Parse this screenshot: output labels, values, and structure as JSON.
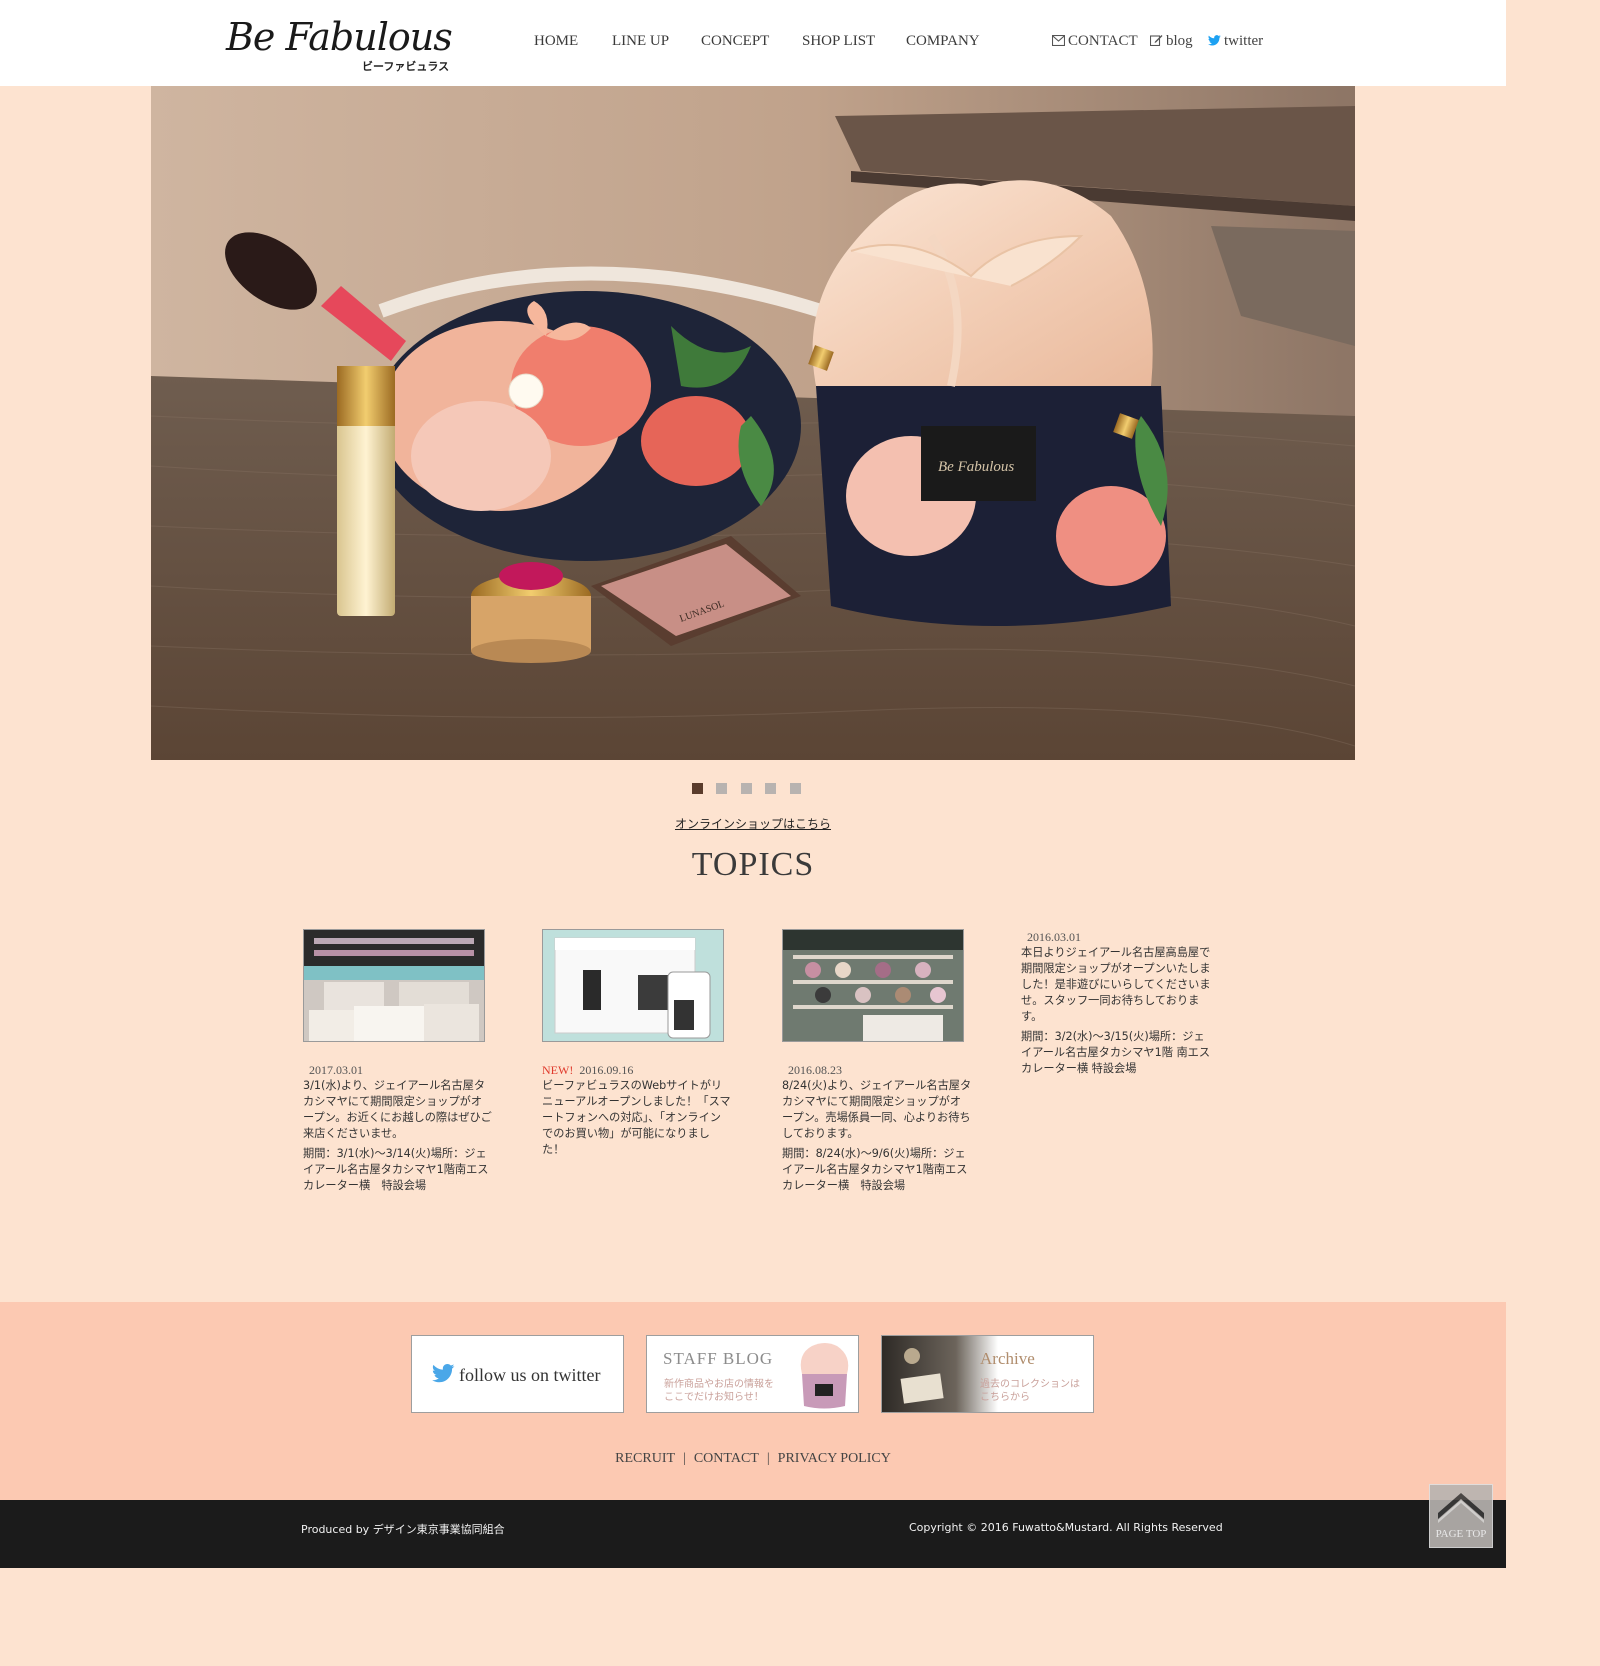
{
  "header": {
    "logo_script": "Be Fabulous",
    "logo_kana": "ビーファビュラス",
    "nav": [
      "HOME",
      "LINE UP",
      "CONCEPT",
      "SHOP LIST",
      "COMPANY"
    ],
    "utility": [
      {
        "label": "CONTACT",
        "icon": "envelope-icon"
      },
      {
        "label": "blog",
        "icon": "edit-icon"
      },
      {
        "label": "twitter",
        "icon": "twitter-bird-icon"
      }
    ]
  },
  "hero": {
    "slide_count": 5,
    "active_slide": 1,
    "bag_tag": "Be Fabulous",
    "compact_text": "LUNASOL"
  },
  "online_shop_link": "オンラインショップはこちら",
  "topics": {
    "title": "TOPICS",
    "items": [
      {
        "new": "",
        "date": "2017.03.01",
        "paragraphs": [
          "3/1(水)より、ジェイアール名古屋タカシマヤにて期間限定ショップがオープン。お近くにお越しの際はぜひご来店くださいませ。",
          "期間：3/1(水)〜3/14(火)場所：ジェイアール名古屋タカシマヤ1階南エスカレーター横　特設会場"
        ]
      },
      {
        "new": "NEW!",
        "date": "2016.09.16",
        "paragraphs": [
          "ビーファビュラスのWebサイトがリニューアルオープンしました！「スマートフォンへの対応」、「オンラインでのお買い物」が可能になりました！"
        ]
      },
      {
        "new": "",
        "date": "2016.08.23",
        "paragraphs": [
          "8/24(火)より、ジェイアール名古屋タカシマヤにて期間限定ショップがオープン。売場係員一同、心よりお待ちしております。",
          "期間：8/24(水)〜9/6(火)場所：ジェイアール名古屋タカシマヤ1階南エスカレーター横　特設会場"
        ]
      },
      {
        "new": "",
        "date": "2016.03.01",
        "paragraphs": [
          "本日よりジェイアール名古屋高島屋で期間限定ショップがオープンいたしました！是非遊びにいらしてくださいませ。スタッフ一同お待ちしております。",
          "期間：3/2(水)〜3/15(火)場所：ジェイアール名古屋タカシマヤ1階 南エスカレーター横 特設会場"
        ]
      }
    ]
  },
  "banners": {
    "twitter": "follow us on twitter",
    "blog_title": "STAFF BLOG",
    "blog_sub1": "新作商品やお店の情報を",
    "blog_sub2": "ここでだけお知らせ！",
    "archive_title": "Archive",
    "archive_sub1": "過去のコレクションは",
    "archive_sub2": "こちらから"
  },
  "footer": {
    "links": [
      "RECRUIT",
      "CONTACT",
      "PRIVACY POLICY"
    ],
    "produced_by": "Produced by デザイン東京事業協同組合",
    "copyright": "Copyright © 2016 Fuwatto&Mustard. All Rights Reserved",
    "page_top": "PAGE TOP"
  },
  "colors": {
    "page_bg": "#fde3d0",
    "footer_band": "#fcc9b2",
    "bottom_bar": "#1b1b1b",
    "new_label": "#e03a2c",
    "dot_active": "#5a3c2c",
    "dot_inactive": "#b8b3b0"
  }
}
